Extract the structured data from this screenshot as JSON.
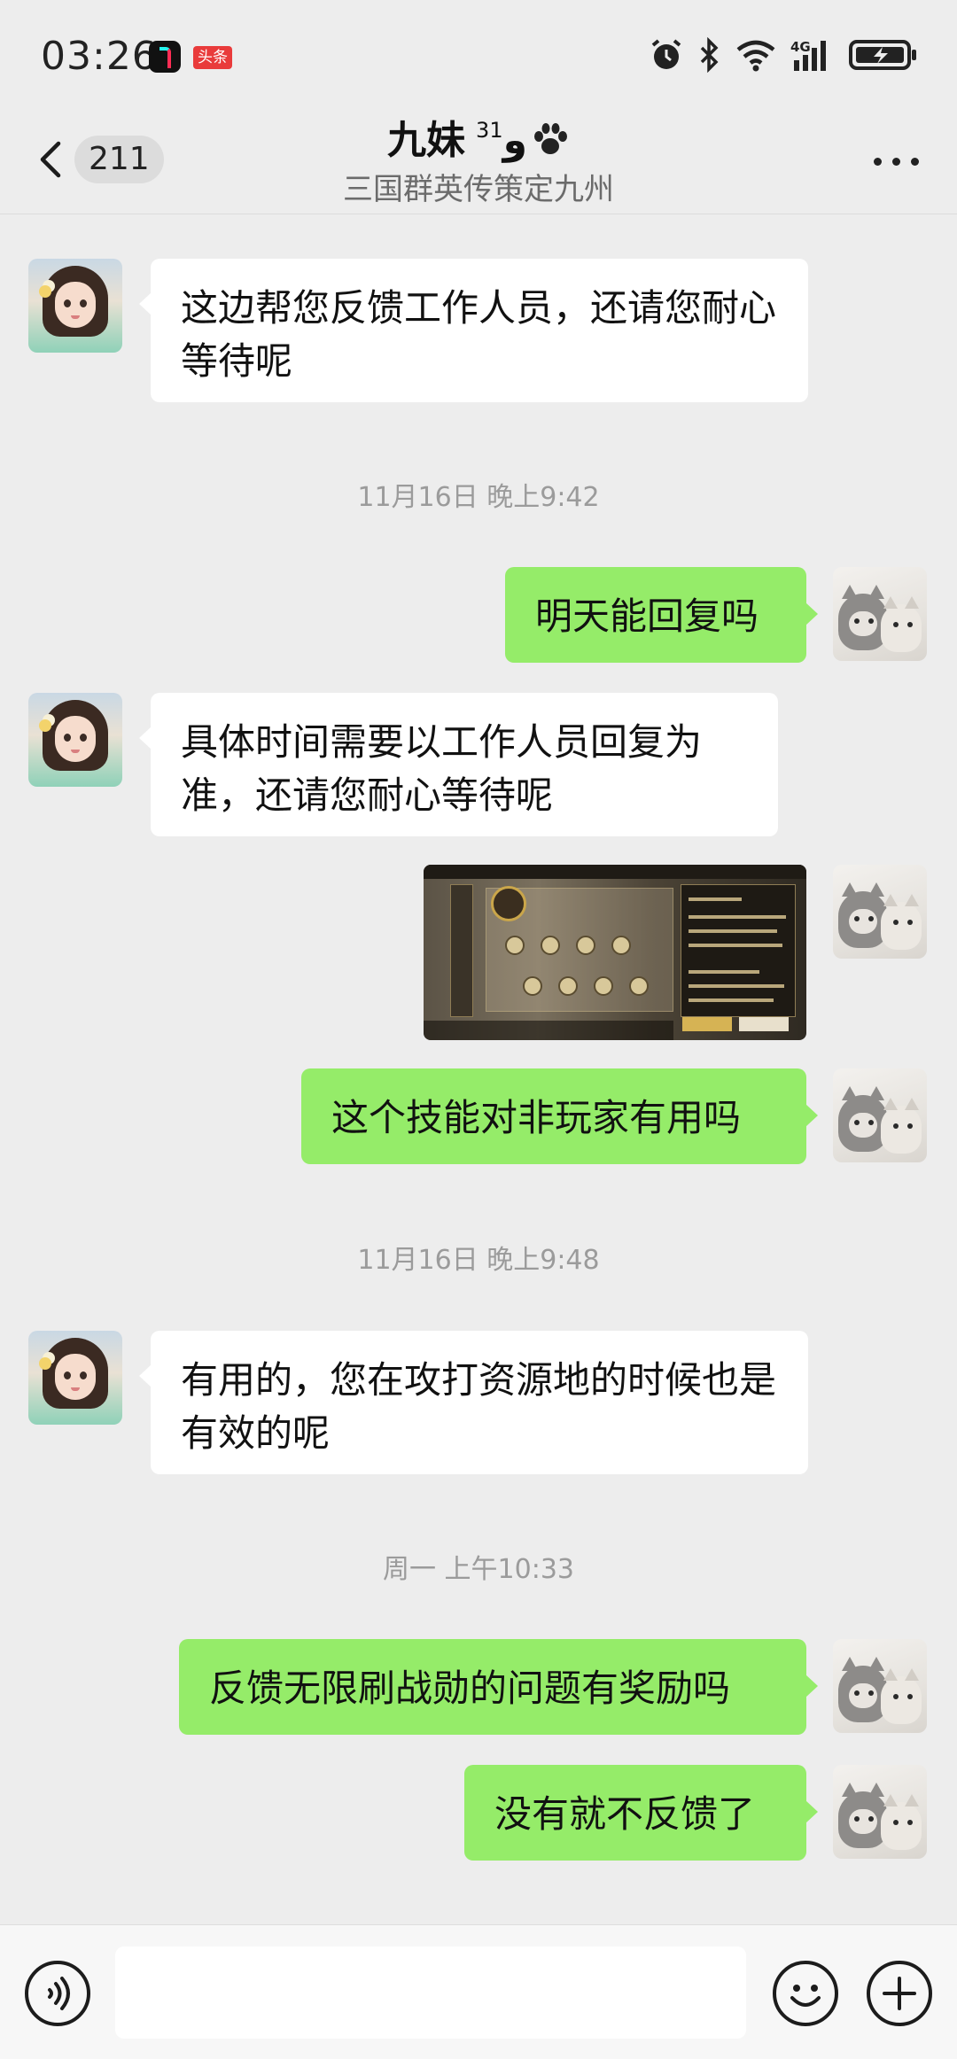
{
  "status_bar": {
    "time": "03:26",
    "toutiao_badge": "头条",
    "network": "4G",
    "icons": [
      "alarm-icon",
      "bluetooth-icon",
      "wifi-icon",
      "signal-icon",
      "battery-charging-icon"
    ]
  },
  "header": {
    "unread_count": "211",
    "contact_name": "九妹",
    "name_superscript": "31",
    "name_suffix": "ﻭ",
    "subtitle": "三国群英传策定九州"
  },
  "messages": [
    {
      "side": "in",
      "text": "这边帮您反馈工作人员，还请您耐心等待呢"
    },
    {
      "type": "timestamp",
      "text": "11月16日 晚上9:42"
    },
    {
      "side": "out",
      "text": "明天能回复吗"
    },
    {
      "side": "in",
      "text": "具体时间需要以工作人员回复为准，还请您耐心等待呢"
    },
    {
      "side": "out",
      "type": "image"
    },
    {
      "side": "out",
      "text": "这个技能对非玩家有用吗"
    },
    {
      "type": "timestamp",
      "text": "11月16日 晚上9:48"
    },
    {
      "side": "in",
      "text": "有用的，您在攻打资源地的时候也是有效的呢"
    },
    {
      "type": "timestamp",
      "text": "周一 上午10:33"
    },
    {
      "side": "out",
      "text": "反馈无限刷战勋的问题有奖励吗"
    },
    {
      "side": "out",
      "text": "没有就不反馈了"
    }
  ],
  "colors": {
    "background": "#ededed",
    "outgoing_bubble": "#95ec69",
    "incoming_bubble": "#ffffff",
    "timestamp_text": "#9b9b9b",
    "toutiao_red": "#e93b3b"
  },
  "input_bar": {
    "value": "",
    "icons": [
      "voice-icon",
      "emoji-icon",
      "plus-icon"
    ]
  }
}
